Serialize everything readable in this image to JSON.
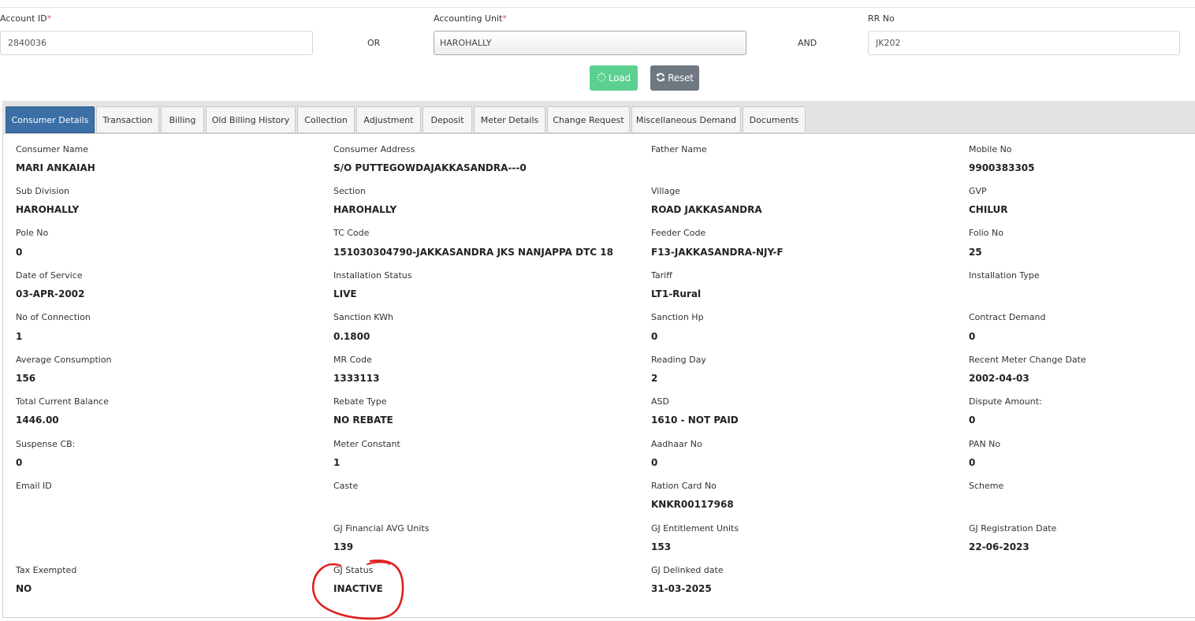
{
  "search": {
    "account_id_label": "Account ID",
    "account_id_value": "2840036",
    "or_text": "OR",
    "accounting_unit_label": "Accounting Unit",
    "accounting_unit_value": "HAROHALLY",
    "and_text": "AND",
    "rr_no_label": "RR No",
    "rr_no_value": "JK202",
    "required_mark": "*",
    "load_label": "Load",
    "reset_label": "Reset"
  },
  "tabs": [
    {
      "label": "Consumer Details",
      "active": true
    },
    {
      "label": "Transaction"
    },
    {
      "label": "Billing"
    },
    {
      "label": "Old Billing History"
    },
    {
      "label": "Collection"
    },
    {
      "label": "Adjustment"
    },
    {
      "label": "Deposit"
    },
    {
      "label": "Meter Details"
    },
    {
      "label": "Change Request"
    },
    {
      "label": "Miscellaneous Demand"
    },
    {
      "label": "Documents"
    }
  ],
  "details": [
    [
      {
        "label": "Consumer Name",
        "value": "MARI ANKAIAH"
      },
      {
        "label": "Consumer Address",
        "value": "S/O PUTTEGOWDAJAKKASANDRA---0"
      },
      {
        "label": "Father Name",
        "value": ""
      },
      {
        "label": "Mobile No",
        "value": "9900383305"
      }
    ],
    [
      {
        "label": "Sub Division",
        "value": "HAROHALLY"
      },
      {
        "label": "Section",
        "value": "HAROHALLY"
      },
      {
        "label": "Village",
        "value": "ROAD JAKKASANDRA"
      },
      {
        "label": "GVP",
        "value": "CHILUR"
      }
    ],
    [
      {
        "label": "Pole No",
        "value": "0"
      },
      {
        "label": "TC Code",
        "value": "151030304790-JAKKASANDRA JKS NANJAPPA DTC 18"
      },
      {
        "label": "Feeder Code",
        "value": "F13-JAKKASANDRA-NJY-F"
      },
      {
        "label": "Folio No",
        "value": "25"
      }
    ],
    [
      {
        "label": "Date of Service",
        "value": "03-APR-2002"
      },
      {
        "label": "Installation Status",
        "value": "LIVE"
      },
      {
        "label": "Tariff",
        "value": "LT1-Rural"
      },
      {
        "label": "Installation Type",
        "value": ""
      }
    ],
    [
      {
        "label": "No of Connection",
        "value": "1"
      },
      {
        "label": "Sanction KWh",
        "value": "0.1800"
      },
      {
        "label": "Sanction Hp",
        "value": "0"
      },
      {
        "label": "Contract Demand",
        "value": "0"
      }
    ],
    [
      {
        "label": "Average Consumption",
        "value": "156"
      },
      {
        "label": "MR Code",
        "value": "1333113"
      },
      {
        "label": "Reading Day",
        "value": "2"
      },
      {
        "label": "Recent Meter Change Date",
        "value": "2002-04-03"
      }
    ],
    [
      {
        "label": "Total Current Balance",
        "value": "1446.00"
      },
      {
        "label": "Rebate Type",
        "value": "NO REBATE"
      },
      {
        "label": "ASD",
        "value": "1610 - NOT PAID"
      },
      {
        "label": "Dispute Amount:",
        "value": "0"
      }
    ],
    [
      {
        "label": "Suspense CB:",
        "value": "0"
      },
      {
        "label": "Meter Constant",
        "value": "1"
      },
      {
        "label": "Aadhaar No",
        "value": "0"
      },
      {
        "label": "PAN No",
        "value": "0"
      }
    ],
    [
      {
        "label": "Email ID",
        "value": ""
      },
      {
        "label": "Caste",
        "value": ""
      },
      {
        "label": "Ration Card No",
        "value": "KNKR00117968"
      },
      {
        "label": "Scheme",
        "value": ""
      }
    ],
    [
      null,
      {
        "label": "GJ Financial AVG Units",
        "value": "139"
      },
      {
        "label": "GJ Entitlement Units",
        "value": "153"
      },
      {
        "label": "GJ Registration Date",
        "value": "22-06-2023"
      }
    ],
    [
      {
        "label": "Tax Exempted",
        "value": "NO"
      },
      {
        "label": "GJ Status",
        "value": "INACTIVE"
      },
      {
        "label": "GJ Delinked date",
        "value": "31-03-2025"
      },
      null
    ]
  ],
  "colors": {
    "accent_active_tab": "#3c6fa6",
    "load_button": "#5cd091",
    "reset_button": "#6f7780",
    "required": "#d9534f",
    "annotation": "#e02020"
  },
  "icons": {
    "load": "spinner-icon",
    "reset": "refresh-icon"
  }
}
